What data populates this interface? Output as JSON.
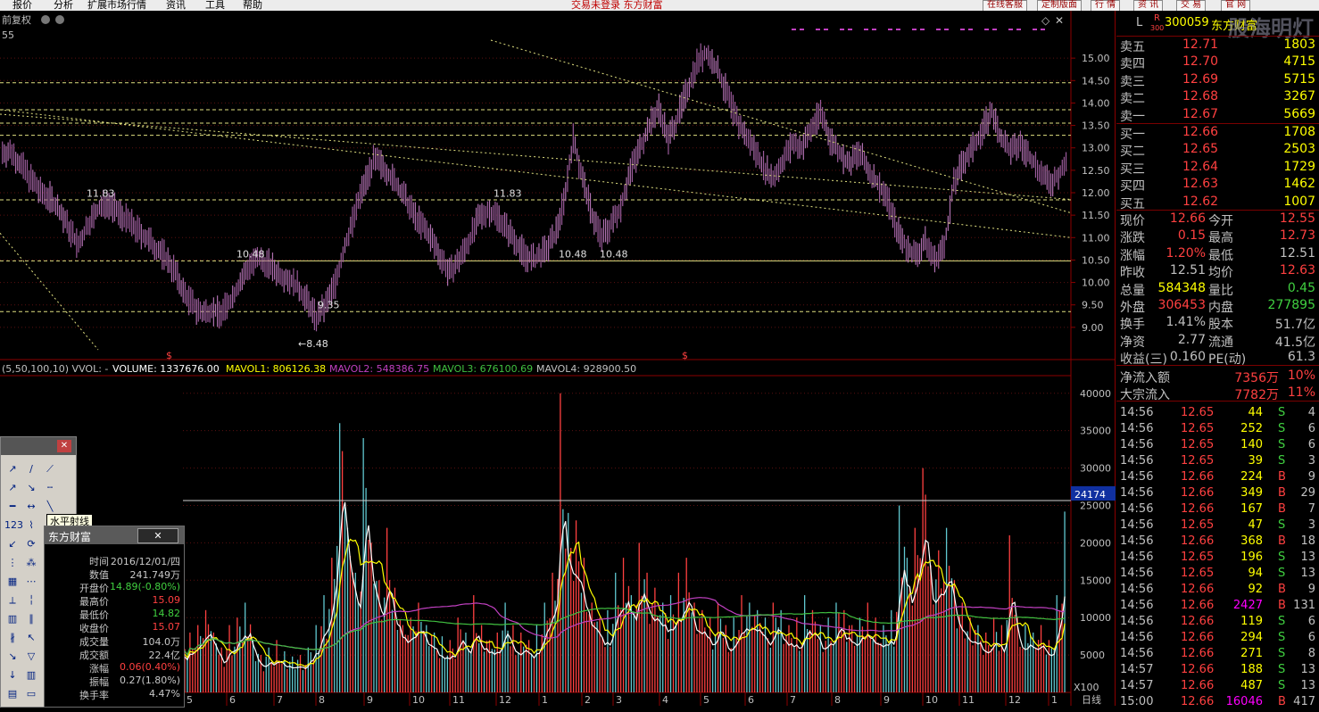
{
  "menu": {
    "items": [
      "报价",
      "分析",
      "扩展市场行情",
      "资讯",
      "工具",
      "帮助"
    ],
    "notice": "交易未登录  东方财富",
    "buttons": [
      "在线客服",
      "定制版面",
      "行 情",
      "资 讯",
      "交 易",
      "官 网"
    ]
  },
  "chart_header": {
    "adjust_label": "前复权",
    "top_left_value": "55",
    "vol_params": "(5,50,100,10) VVOL: -",
    "volume": "VOLUME: 1337676.00",
    "mavol1": "MAVOL1: 806126.38",
    "mavol2": "MAVOL2: 548386.75",
    "mavol3": "MAVOL3: 676100.69",
    "mavol4": "MAVOL4: 928900.50",
    "vol_marker_value": "24174",
    "vol_unit": "X100",
    "period": "日线"
  },
  "colors": {
    "price_bars": "#b070b0",
    "vol_up": "#ff4040",
    "vol_down": "#60c8d0",
    "mavol1": "#ffffff",
    "mavol2": "#ffff00",
    "mavol3": "#c040c0",
    "mavol4": "#40c040",
    "level": "#e0e080",
    "accent": "#ff4040"
  },
  "chart_data": [
    {
      "type": "line",
      "ylim": [
        8.5,
        15.5
      ],
      "yticks": [
        "15.00",
        "14.50",
        "14.00",
        "13.50",
        "13.00",
        "12.50",
        "12.00",
        "11.50",
        "11.00",
        "10.50",
        "10.00",
        "9.50",
        "9.00"
      ],
      "annotations": [
        "11.83",
        "11.83",
        "10.48",
        "10.48",
        "10.48",
        "9.35",
        "←8.48"
      ],
      "markers": [
        "$",
        "$"
      ],
      "series": [
        {
          "values": [
            12.9,
            12.6,
            12.3,
            12.0,
            11.9,
            11.6,
            11.2,
            10.8,
            11.3,
            11.6,
            11.8,
            11.6,
            11.4,
            11.2,
            11.0,
            10.8,
            10.6,
            10.3,
            9.8,
            9.5,
            9.3,
            9.4,
            9.3,
            9.6,
            10.0,
            10.4,
            10.5,
            10.4,
            10.2,
            10.1,
            9.9,
            9.6,
            9.2,
            9.5,
            10.0,
            10.8,
            11.5,
            12.2,
            12.7,
            12.6,
            12.3,
            12.0,
            11.6,
            11.3,
            11.0,
            10.6,
            10.2,
            10.5,
            10.9,
            11.4,
            11.6,
            11.5,
            11.2,
            10.9,
            10.6,
            10.5,
            10.7,
            11.0,
            11.8,
            13.2,
            12.3,
            11.5,
            11.0,
            11.3,
            11.7,
            12.5,
            13.0,
            13.5,
            13.9,
            13.2,
            13.7,
            14.3,
            14.9,
            15.1,
            14.8,
            14.3,
            13.7,
            13.3,
            13.0,
            12.6,
            12.3,
            12.7,
            13.1,
            13.0,
            13.4,
            13.8,
            13.2,
            12.9,
            12.6,
            12.9,
            12.5,
            12.2,
            11.9,
            11.2,
            10.8,
            10.6,
            10.9,
            10.5,
            10.8,
            12.2,
            12.7,
            13.0,
            13.4,
            13.8,
            13.2,
            12.9,
            13.1,
            12.8,
            12.5,
            12.2,
            12.4,
            12.66
          ]
        }
      ]
    },
    {
      "type": "bar",
      "ylim": [
        0,
        42000
      ],
      "yticks": [
        "40000",
        "35000",
        "30000",
        "25000",
        "20000",
        "15000",
        "10000",
        "5000"
      ],
      "xticks": [
        "5",
        "6",
        "7",
        "8",
        "9",
        "10",
        "11",
        "12",
        "1",
        "2",
        "3",
        "4",
        "5",
        "6",
        "7",
        "8",
        "9",
        "10",
        "11",
        "12",
        "1"
      ],
      "series": [
        {
          "name": "VOLUME",
          "values": [
            8000,
            9000,
            11000,
            8000,
            6000,
            9000,
            10000,
            12000,
            7000,
            5000,
            6000,
            7000,
            5500,
            4800,
            5000,
            6000,
            9000,
            13000,
            18000,
            36000,
            22000,
            16000,
            34000,
            20000,
            15000,
            22000,
            14000,
            9000,
            10000,
            12000,
            9000,
            8000,
            7500,
            7000,
            10000,
            8000,
            13000,
            9000,
            7000,
            8000,
            12000,
            9000,
            8000,
            7000,
            9000,
            12000,
            16000,
            40000,
            24000,
            23000,
            18000,
            12000,
            10000,
            11000,
            16000,
            18000,
            13000,
            20000,
            16000,
            14000,
            12000,
            13000,
            16000,
            18000,
            12000,
            11000,
            10000,
            12000,
            9000,
            10000,
            13000,
            12000,
            11000,
            10000,
            12000,
            11000,
            9000,
            10000,
            13000,
            11000,
            9000,
            10000,
            12000,
            11000,
            9000,
            10000,
            12000,
            10000,
            9000,
            11000,
            25000,
            18000,
            22000,
            30000,
            17000,
            19000,
            22000,
            15000,
            12000,
            10000,
            9000,
            8000,
            10000,
            9000,
            21000,
            10000,
            9000,
            8000,
            9000,
            7000,
            13000,
            24174
          ]
        }
      ]
    }
  ],
  "stock": {
    "code": "300059",
    "name": "东方财富",
    "flag_l": "L",
    "flag_r": "R",
    "flag_300": "300",
    "watermark": "股海明灯"
  },
  "order_book": [
    {
      "label": "卖五",
      "price": "12.71",
      "vol": "1803"
    },
    {
      "label": "卖四",
      "price": "12.70",
      "vol": "4715"
    },
    {
      "label": "卖三",
      "price": "12.69",
      "vol": "5715"
    },
    {
      "label": "卖二",
      "price": "12.68",
      "vol": "3267"
    },
    {
      "label": "卖一",
      "price": "12.67",
      "vol": "5669"
    },
    {
      "label": "买一",
      "price": "12.66",
      "vol": "1708"
    },
    {
      "label": "买二",
      "price": "12.65",
      "vol": "2503"
    },
    {
      "label": "买三",
      "price": "12.64",
      "vol": "1729"
    },
    {
      "label": "买四",
      "price": "12.63",
      "vol": "1462"
    },
    {
      "label": "买五",
      "price": "12.62",
      "vol": "1007"
    }
  ],
  "stats": [
    {
      "l1": "现价",
      "v1": "12.66",
      "l2": "今开",
      "v2": "12.55"
    },
    {
      "l1": "涨跌",
      "v1": "0.15",
      "l2": "最高",
      "v2": "12.73"
    },
    {
      "l1": "涨幅",
      "v1": "1.20%",
      "l2": "最低",
      "v2": "12.51"
    },
    {
      "l1": "昨收",
      "v1": "12.51",
      "l2": "均价",
      "v2": "12.63"
    },
    {
      "l1": "总量",
      "v1": "584348",
      "l2": "量比",
      "v2": "0.45"
    },
    {
      "l1": "外盘",
      "v1": "306453",
      "l2": "内盘",
      "v2": "277895"
    },
    {
      "l1": "换手",
      "v1": "1.41%",
      "l2": "股本",
      "v2": "51.7亿"
    },
    {
      "l1": "净资",
      "v1": "2.77",
      "l2": "流通",
      "v2": "41.5亿"
    },
    {
      "l1": "收益(三)",
      "v1": "0.160",
      "l2": "PE(动)",
      "v2": "61.3"
    }
  ],
  "flows": [
    {
      "label": "净流入额",
      "value": "7356万",
      "pct": "10%"
    },
    {
      "label": "大宗流入",
      "value": "7782万",
      "pct": "11%"
    }
  ],
  "ticks": [
    {
      "time": "14:56",
      "price": "12.65",
      "vol": "44",
      "side": "S",
      "num": "4"
    },
    {
      "time": "14:56",
      "price": "12.65",
      "vol": "252",
      "side": "S",
      "num": "6"
    },
    {
      "time": "14:56",
      "price": "12.65",
      "vol": "140",
      "side": "S",
      "num": "6"
    },
    {
      "time": "14:56",
      "price": "12.65",
      "vol": "39",
      "side": "S",
      "num": "3"
    },
    {
      "time": "14:56",
      "price": "12.66",
      "vol": "224",
      "side": "B",
      "num": "9"
    },
    {
      "time": "14:56",
      "price": "12.66",
      "vol": "349",
      "side": "B",
      "num": "29"
    },
    {
      "time": "14:56",
      "price": "12.66",
      "vol": "167",
      "side": "B",
      "num": "7"
    },
    {
      "time": "14:56",
      "price": "12.65",
      "vol": "47",
      "side": "S",
      "num": "3"
    },
    {
      "time": "14:56",
      "price": "12.66",
      "vol": "368",
      "side": "B",
      "num": "18"
    },
    {
      "time": "14:56",
      "price": "12.65",
      "vol": "196",
      "side": "S",
      "num": "13"
    },
    {
      "time": "14:56",
      "price": "12.65",
      "vol": "94",
      "side": "S",
      "num": "13"
    },
    {
      "time": "14:56",
      "price": "12.66",
      "vol": "92",
      "side": "B",
      "num": "9"
    },
    {
      "time": "14:56",
      "price": "12.66",
      "vol": "2427",
      "side": "B",
      "num": "131"
    },
    {
      "time": "14:56",
      "price": "12.66",
      "vol": "119",
      "side": "S",
      "num": "6"
    },
    {
      "time": "14:56",
      "price": "12.66",
      "vol": "294",
      "side": "S",
      "num": "6"
    },
    {
      "time": "14:56",
      "price": "12.66",
      "vol": "271",
      "side": "S",
      "num": "8"
    },
    {
      "time": "14:57",
      "price": "12.66",
      "vol": "188",
      "side": "S",
      "num": "13"
    },
    {
      "time": "14:57",
      "price": "12.66",
      "vol": "487",
      "side": "S",
      "num": "13"
    },
    {
      "time": "15:00",
      "price": "12.66",
      "vol": "16046",
      "side": "B",
      "num": "417"
    }
  ],
  "tool_panel": {
    "tooltip": "水平射线",
    "glyphs": [
      "↗",
      "∕",
      "⟋",
      "↗",
      "↘",
      "╌",
      "━",
      "↔",
      "╲",
      "123",
      "⌇",
      "⟍",
      "↙",
      "⟳",
      "○",
      "⋮",
      "⁂",
      "⊞",
      "▦",
      "⋯",
      "╪",
      "⟂",
      "╎",
      "⊟",
      "▥",
      "∥",
      "⫼",
      "∦",
      "↖",
      "↓",
      "↘",
      "▽",
      "↑",
      "↓",
      "▥",
      "✕",
      "▤",
      "▭",
      "▣"
    ]
  },
  "info_window": {
    "title": "东方财富",
    "close": "✕",
    "rows": [
      {
        "label": "时间",
        "value": "2016/12/01/四",
        "color": "#c8c8c8"
      },
      {
        "label": "数值",
        "value": "241.749万",
        "color": "#c8c8c8"
      },
      {
        "label": "开盘价",
        "value": "14.89(-0.80%)",
        "color": "#40d040"
      },
      {
        "label": "最高价",
        "value": "15.09",
        "color": "#ff4040"
      },
      {
        "label": "最低价",
        "value": "14.82",
        "color": "#40d040"
      },
      {
        "label": "收盘价",
        "value": "15.07",
        "color": "#ff4040"
      },
      {
        "label": "成交量",
        "value": "104.0万",
        "color": "#c8c8c8"
      },
      {
        "label": "成交额",
        "value": "22.4亿",
        "color": "#c8c8c8"
      },
      {
        "label": "涨幅",
        "value": "0.06(0.40%)",
        "color": "#ff4040"
      },
      {
        "label": "振幅",
        "value": "0.27(1.80%)",
        "color": "#c8c8c8"
      },
      {
        "label": "换手率",
        "value": "4.47%",
        "color": "#c8c8c8"
      }
    ]
  }
}
